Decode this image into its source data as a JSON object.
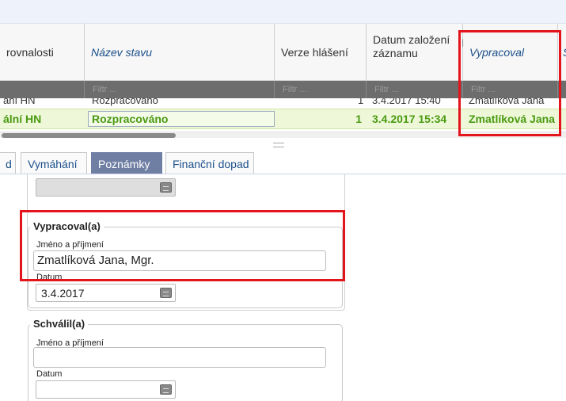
{
  "grid": {
    "headers": {
      "col1": "rovnalosti",
      "col2": "Název stavu",
      "col3": "Verze hlášení",
      "col4": "Datum založení záznamu",
      "col5": "Vypracoval",
      "col6": "S"
    },
    "filter_placeholder": "Filtr ...",
    "partial_row": {
      "c1": "ání HN",
      "c2": "Rozpracováno",
      "c3": "1",
      "c4": "3.4.2017 15:40",
      "c5": "Zmatlíková Jana"
    },
    "selected_row": {
      "c1": "ální HN",
      "c2": "Rozpracováno",
      "c3": "1",
      "c4": "3.4.2017 15:34",
      "c5": "Zmatlíková Jana"
    }
  },
  "tabs": [
    {
      "label": "d"
    },
    {
      "label": "Vymáhání"
    },
    {
      "label": "Poznámky",
      "active": true
    },
    {
      "label": "Finanční dopad"
    }
  ],
  "form": {
    "vypracoval": {
      "legend": "Vypracoval(a)",
      "name_label": "Jméno a příjmení",
      "name_value": "Zmatlíková Jana, Mgr.",
      "date_label": "Datum",
      "date_value": "3.4.2017"
    },
    "schvalil": {
      "legend": "Schválil(a)",
      "name_label": "Jméno a příjmení",
      "name_value": "",
      "date_label": "Datum",
      "date_value": ""
    }
  },
  "colors": {
    "selected_row_text": "#4a9a12",
    "active_tab": "#6f7fa3",
    "highlight": "#e3141c",
    "italic_header": "#1b4f8a"
  }
}
